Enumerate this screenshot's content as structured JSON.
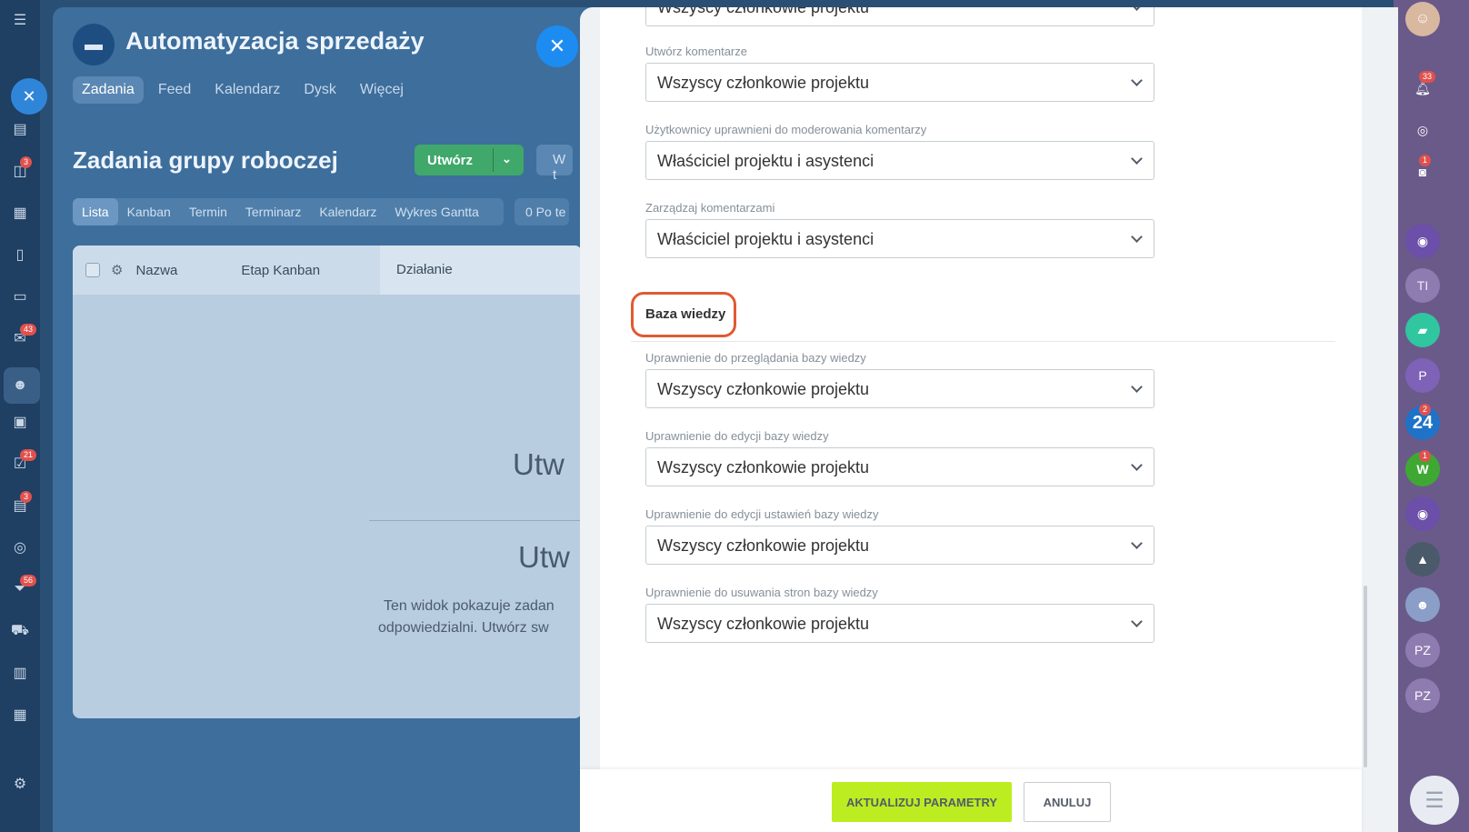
{
  "left_sidebar": {
    "badges": [
      "3",
      "43",
      "21",
      "3",
      "56"
    ]
  },
  "background": {
    "group_title": "Automatyzacja sprzedaży",
    "nav_tabs": [
      "Zadania",
      "Feed",
      "Kalendarz",
      "Dysk",
      "Więcej"
    ],
    "page_title": "Zadania grupy roboczej",
    "create_label": "Utwórz",
    "search_stub": "W t",
    "views": [
      "Lista",
      "Kanban",
      "Termin",
      "Terminarz",
      "Kalendarz",
      "Wykres Gantta"
    ],
    "counter_pill": "0  Po te",
    "table_headers": {
      "name": "Nazwa",
      "kanban": "Etap Kanban",
      "action": "Działanie"
    },
    "empty_title_1": "Utw",
    "empty_title_2": "Utw",
    "empty_desc_1": "Ten widok pokazuje zadan",
    "empty_desc_2": "odpowiedzialni. Utwórz sw"
  },
  "right_sidebar": {
    "notify_badge": "33",
    "chat_badge": "1",
    "b24_label": "24",
    "b24_badge": "2",
    "w_label": "W",
    "w_badge": "1",
    "ti_label": "TI",
    "p_label": "P",
    "pz1_label": "PZ",
    "pz2_label": "PZ"
  },
  "form": {
    "top_cut_value": "Wszyscy członkowie projektu",
    "fields_comments": [
      {
        "label": "Utwórz komentarze",
        "value": "Wszyscy członkowie projektu"
      },
      {
        "label": "Użytkownicy uprawnieni do moderowania komentarzy",
        "value": "Właściciel projektu i asystenci"
      },
      {
        "label": "Zarządzaj komentarzami",
        "value": "Właściciel projektu i asystenci"
      }
    ],
    "section_title": "Baza wiedzy",
    "fields_kb": [
      {
        "label": "Uprawnienie do przeglądania bazy wiedzy",
        "value": "Wszyscy członkowie projektu"
      },
      {
        "label": "Uprawnienie do edycji bazy wiedzy",
        "value": "Wszyscy członkowie projektu"
      },
      {
        "label": "Uprawnienie do edycji ustawień bazy wiedzy",
        "value": "Wszyscy członkowie projektu"
      },
      {
        "label": "Uprawnienie do usuwania stron bazy wiedzy",
        "value": "Wszyscy członkowie projektu"
      }
    ]
  },
  "footer": {
    "save_label": "AKTUALIZUJ PARAMETRY",
    "cancel_label": "ANULUJ"
  },
  "colors": {
    "save_button": "#bbed21",
    "highlight": "#e05a32"
  }
}
